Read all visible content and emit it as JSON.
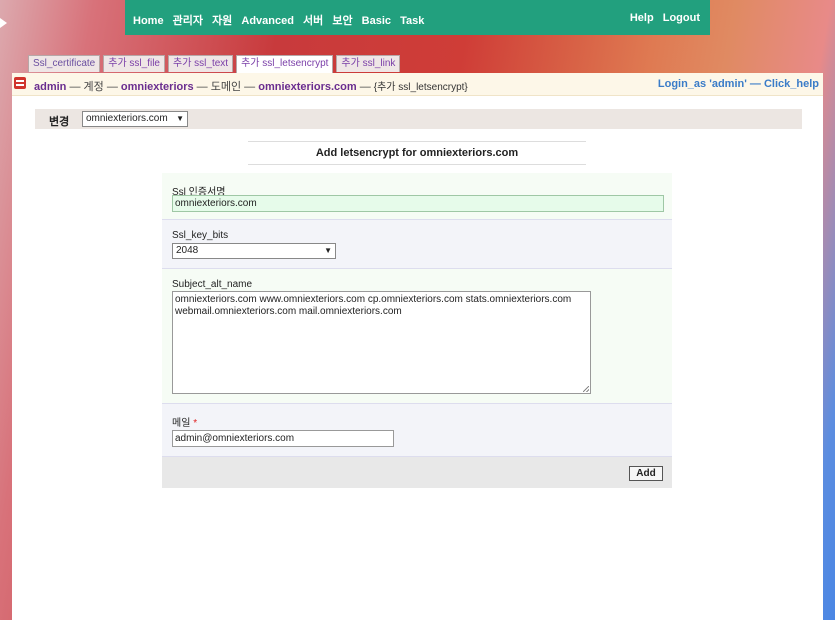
{
  "topnav": {
    "left": [
      "Home",
      "관리자",
      "자원",
      "Advanced",
      "서버",
      "보안",
      "Basic",
      "Task"
    ],
    "right": [
      "Help",
      "Logout"
    ]
  },
  "tabs": [
    "Ssl_certificate",
    "추가 ssl_file",
    "추가 ssl_text",
    "추가 ssl_letsencrypt",
    "추가 ssl_link"
  ],
  "breadcrumb": {
    "admin": "admin",
    "sep1": " — 계정 — ",
    "account": "omniexteriors",
    "sep2": " — 도메인 — ",
    "domain": "omniexteriors.com",
    "sep3": " — ",
    "current": "{추가 ssl_letsencrypt}",
    "login_as": "Login_as 'admin'",
    "sep4": " — ",
    "click_help": "Click_help"
  },
  "change": {
    "label": "변경",
    "selected": "omniexteriors.com"
  },
  "form": {
    "title": "Add letsencrypt for omniexteriors.com",
    "cert_name_label": "Ssl 인증서명",
    "cert_name_value": "omniexteriors.com",
    "key_bits_label": "Ssl_key_bits",
    "key_bits_value": "2048",
    "san_label": "Subject_alt_name",
    "san_value": "omniexteriors.com www.omniexteriors.com cp.omniexteriors.com stats.omniexteriors.com webmail.omniexteriors.com mail.omniexteriors.com",
    "email_label": "메일",
    "required_mark": "*",
    "email_value": "admin@omniexteriors.com",
    "add_button": "Add"
  },
  "icons": {
    "cursor": "cursor-arrow-icon",
    "breadcrumb": "account-icon",
    "dropdown": "chevron-down-icon",
    "resize": "resize-grip-icon"
  },
  "colors": {
    "topbar": "#22a07e",
    "link": "#6a2d8f",
    "help_link": "#3a7cc8",
    "highlight_input": "#e6fbea"
  }
}
